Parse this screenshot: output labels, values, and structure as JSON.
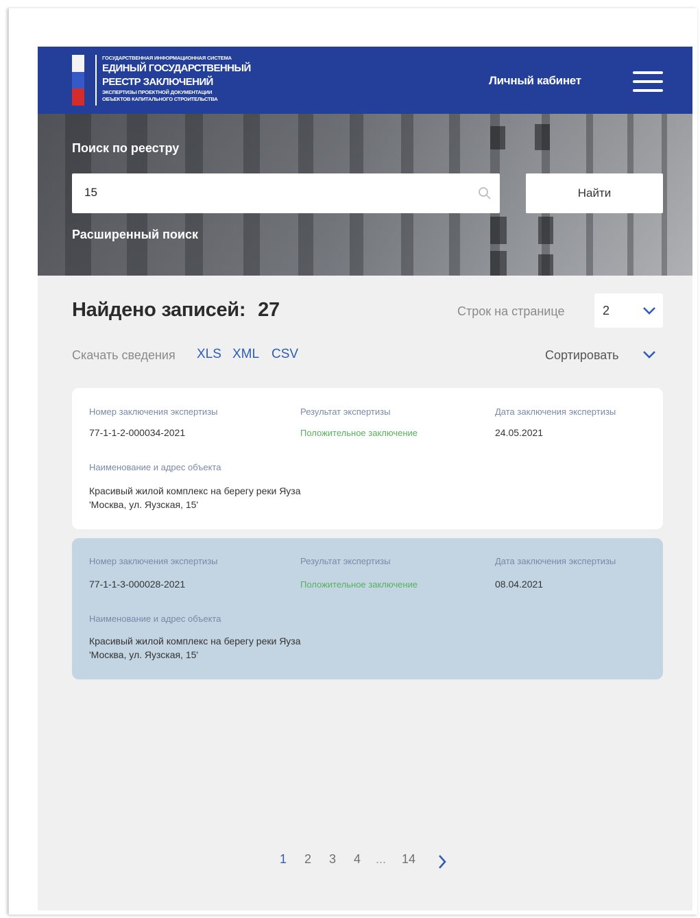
{
  "header": {
    "logo_line1": "Государственная информационная система",
    "logo_line2": "Единый государственный",
    "logo_line3": "реестр заключений",
    "logo_line4": "экспертизы проектной документации",
    "logo_line5": "объектов капитального строительства",
    "cabinet_link": "Личный кабинет",
    "menu_icon": "hamburger-menu-icon"
  },
  "hero": {
    "title": "Поиск по реестру",
    "search_value": "15",
    "search_icon": "search-icon",
    "find_button": "Найти",
    "advanced_link": "Расширенный поиск"
  },
  "results": {
    "found_label": "Найдено записей:",
    "found_count": "27",
    "rows_label": "Строк на странице",
    "rows_value": "2",
    "download_label": "Скачать сведения",
    "formats": [
      "XLS",
      "XML",
      "CSV"
    ],
    "sort_label": "Сортировать",
    "labels": {
      "number": "Номер заключения экспертизы",
      "result": "Результат экспертизы",
      "date": "Дата заключения экспертизы",
      "object": "Наименование и адрес объекта"
    },
    "items": [
      {
        "number": "77-1-1-2-000034-2021",
        "result": "Положительное заключение",
        "date": "24.05.2021",
        "object_name": "Красивый жилой комплекс на берегу реки Яуза",
        "object_address": "'Москва, ул. Яузская, 15'"
      },
      {
        "number": "77-1-1-3-000028-2021",
        "result": "Положительное заключение",
        "date": "08.04.2021",
        "object_name": "Красивый жилой комплекс на берегу реки Яуза",
        "object_address": "'Москва, ул. Яузская, 15'"
      }
    ]
  },
  "pagination": {
    "pages": [
      "1",
      "2",
      "3",
      "4",
      "...",
      "14"
    ],
    "current": "1",
    "next_icon": "chevron-right-icon"
  },
  "colors": {
    "header_bg": "#243f9a",
    "link": "#2f5cb8",
    "result_positive": "#55b25a",
    "selected_card": "#c3d4e2"
  }
}
